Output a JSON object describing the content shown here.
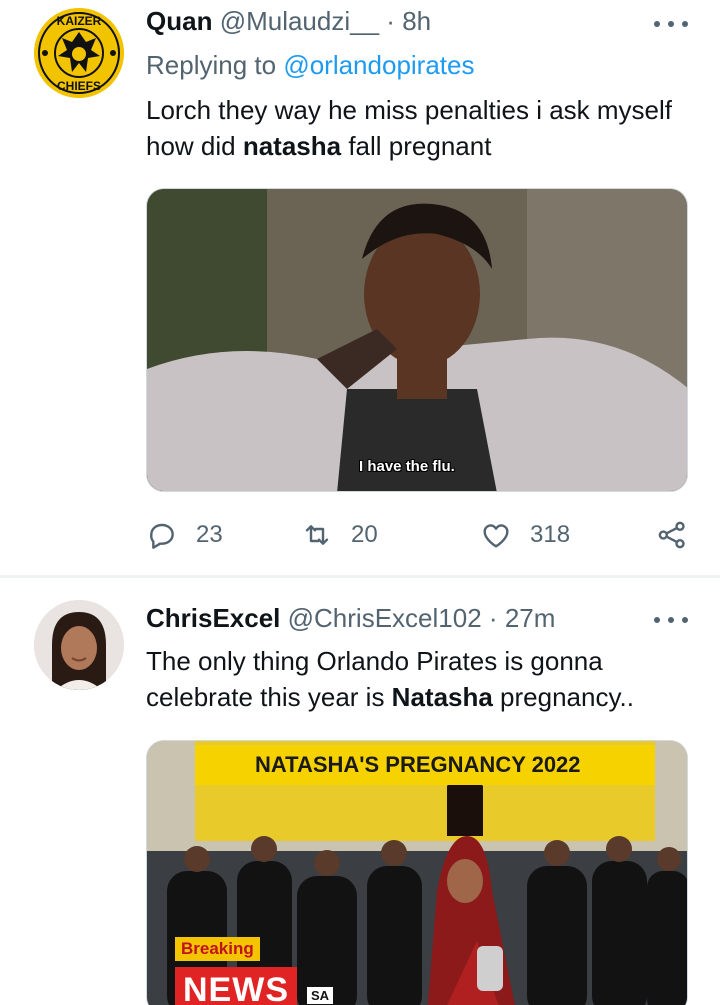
{
  "tweets": [
    {
      "name": "Quan",
      "handle": "@Mulaudzi__",
      "dot": "·",
      "time": "8h",
      "reply_prefix": "Replying to",
      "reply_to": "@orlandopirates",
      "text_before": "Lorch they way he miss penalties i ask myself how did ",
      "text_bold": "natasha",
      "text_after": " fall pregnant",
      "avatar_text_top": "KAIZER",
      "avatar_text_bottom": "CHIEFS",
      "media_caption": "I have the flu.",
      "counts": {
        "replies": "23",
        "retweets": "20",
        "likes": "318"
      }
    },
    {
      "name": "ChrisExcel",
      "handle": "@ChrisExcel102",
      "dot": "·",
      "time": "27m",
      "text_before": "The only thing Orlando Pirates is gonna celebrate this year is ",
      "text_bold": "Natasha",
      "text_after": " pregnancy..",
      "media_banner": "NATASHA'S PREGNANCY 2022",
      "media_breaking": "Breaking",
      "media_news": "NEWS",
      "media_news_tag": "SA"
    }
  ],
  "colors": {
    "text_primary": "#0f1419",
    "text_secondary": "#536471",
    "link": "#1d9bf0",
    "divider": "#eff3f4"
  },
  "icons": [
    "more-icon",
    "reply-icon",
    "retweet-icon",
    "like-icon",
    "share-icon"
  ]
}
